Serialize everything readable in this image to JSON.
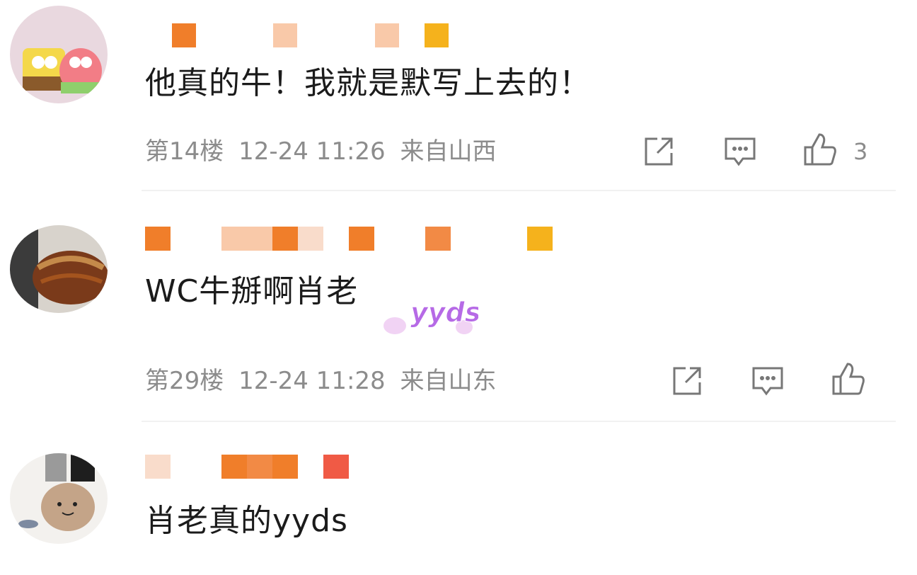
{
  "comments": [
    {
      "text": "他真的牛！我就是默写上去的！",
      "floor": "第14楼",
      "time": "12-24 11:26",
      "location": "来自山西",
      "like_count": "3"
    },
    {
      "text": "WC牛掰啊肖老",
      "floor": "第29楼",
      "time": "12-24 11:28",
      "location": "来自山东",
      "sticker_text": "yyds"
    },
    {
      "text": "肖老真的yyds"
    }
  ],
  "colors": {
    "meta_gray": "#8c8c8c",
    "name_orange": "#f07e2a",
    "name_peach": "#f9c9a9",
    "name_gold": "#f5b21c",
    "name_red": "#f05a45"
  },
  "icons": [
    "share-icon",
    "comment-icon",
    "like-icon"
  ]
}
